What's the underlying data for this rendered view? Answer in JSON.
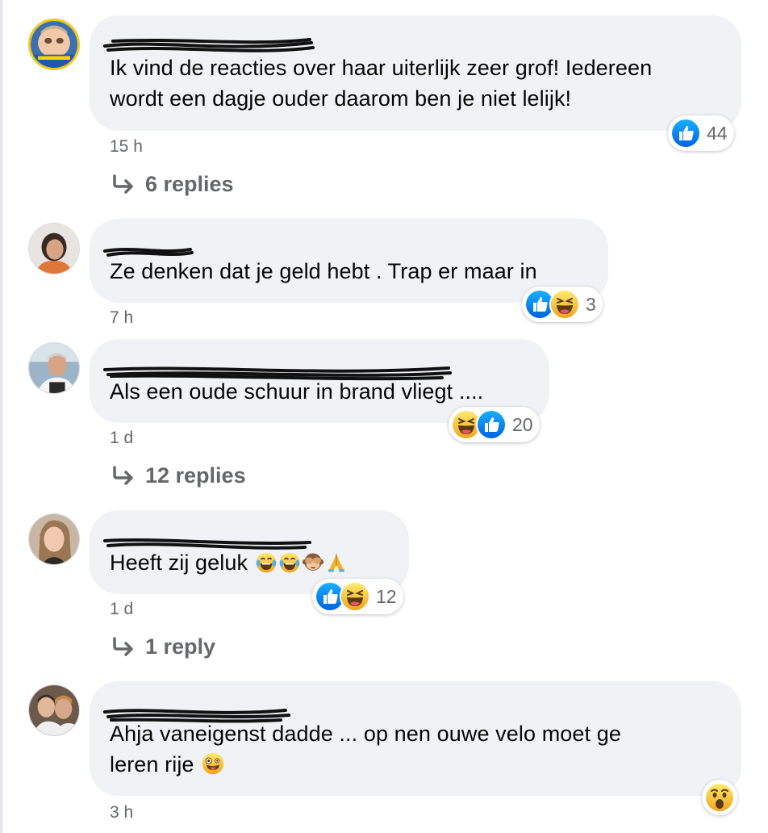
{
  "comments": [
    {
      "text": "Ik vind de reacties over haar uiterlijk zeer grof! Iedereen",
      "text2": "wordt een dagje ouder daarom ben je niet lelijk!",
      "time": "15 h",
      "reaction_icons": [
        "like-icon"
      ],
      "reaction_count": "44",
      "replies": "6 replies"
    },
    {
      "text": "Ze denken dat je geld hebt . Trap er maar in",
      "time": "7 h",
      "reaction_icons": [
        "like-icon",
        "haha-icon"
      ],
      "reaction_count": "3"
    },
    {
      "text": "Als een oude schuur in brand vliegt ....",
      "time": "1 d",
      "reaction_icons": [
        "haha-icon",
        "like-icon"
      ],
      "reaction_count": "20",
      "replies": "12 replies"
    },
    {
      "text": "Heeft zij geluk",
      "inline_emojis": [
        "tears-of-joy-emoji",
        "tears-of-joy-emoji",
        "see-no-evil-monkey-emoji",
        "folded-hands-emoji"
      ],
      "time": "1 d",
      "reaction_icons": [
        "like-icon",
        "haha-icon"
      ],
      "reaction_count": "12",
      "replies": "1 reply"
    },
    {
      "text": "Ahja vaneigenst dadde ... op nen ouwe velo moet ge",
      "text2": "leren rije",
      "inline_emojis": [
        "zany-face-emoji"
      ],
      "time": "3 h",
      "reaction_icons": [
        "wow-icon"
      ]
    }
  ],
  "colors": {
    "bubble": "#f0f2f5",
    "secondary_text": "#65676b",
    "like_blue": "#1877f2",
    "emoji_yellow": "#f7b125"
  }
}
